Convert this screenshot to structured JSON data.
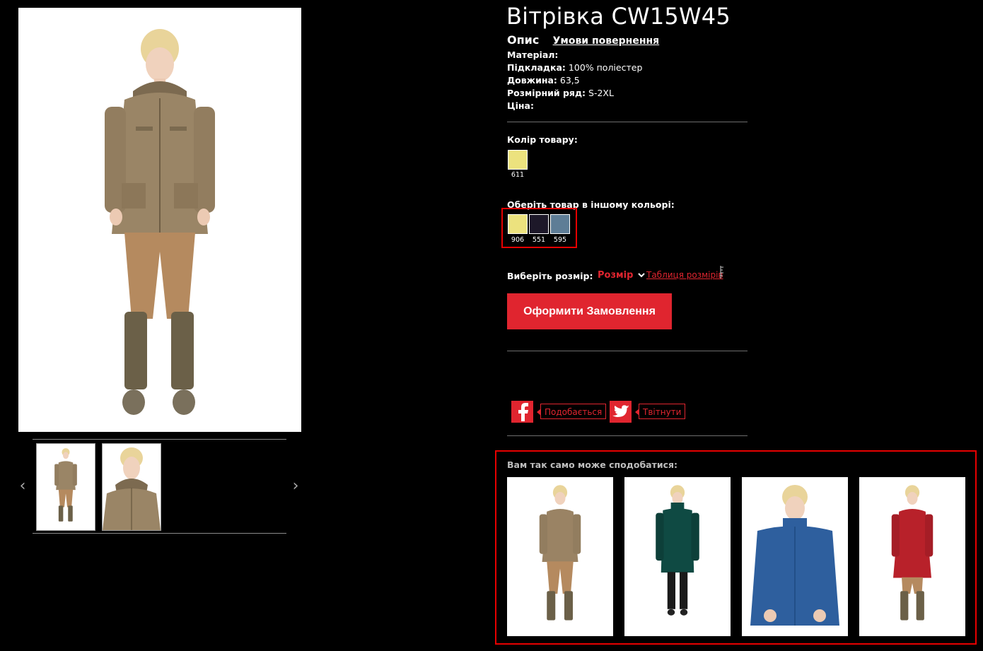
{
  "product": {
    "title": "Вітрівка CW15W45",
    "tabs": {
      "description": "Опис",
      "return": "Умови повернення"
    },
    "specs": [
      {
        "label": "Матеріал:",
        "value": ""
      },
      {
        "label": "Підкладка:",
        "value": " 100% поліестер"
      },
      {
        "label": "Довжина:",
        "value": " 63,5"
      },
      {
        "label": "Розмірний ряд:",
        "value": " S-2XL"
      },
      {
        "label": "Ціна:",
        "value": ""
      }
    ],
    "color_label": "Колір товару:",
    "current_color": {
      "code": "611",
      "hex": "#ece27e"
    },
    "other_colors_label": "Оберіть товар в іншому кольорі:",
    "other_colors": [
      {
        "code": "906",
        "hex": "#ece27e"
      },
      {
        "code": "551",
        "hex": "#1d1829"
      },
      {
        "code": "595",
        "hex": "#5e7d96"
      }
    ],
    "size_label": "Виберіть розмір:",
    "size_select": "Розмір",
    "size_table": "Таблиця розмірів",
    "order_button": "Оформити Замовлення"
  },
  "social": {
    "facebook": "Подобається",
    "twitter": "Твітнути"
  },
  "recommendations": {
    "title": "Вам так само може сподобатися:",
    "items": [
      {
        "coat": "#9a8364"
      },
      {
        "coat": "#0f4a43"
      },
      {
        "coat": "#2e5f9e"
      },
      {
        "coat": "#b8212a"
      }
    ]
  },
  "colors": {
    "accent": "#e0252f",
    "highlight": "#e60000"
  },
  "icons": [
    "chevron-left-icon",
    "chevron-right-icon",
    "chevron-down-icon",
    "ruler-icon",
    "facebook-icon",
    "twitter-icon"
  ]
}
